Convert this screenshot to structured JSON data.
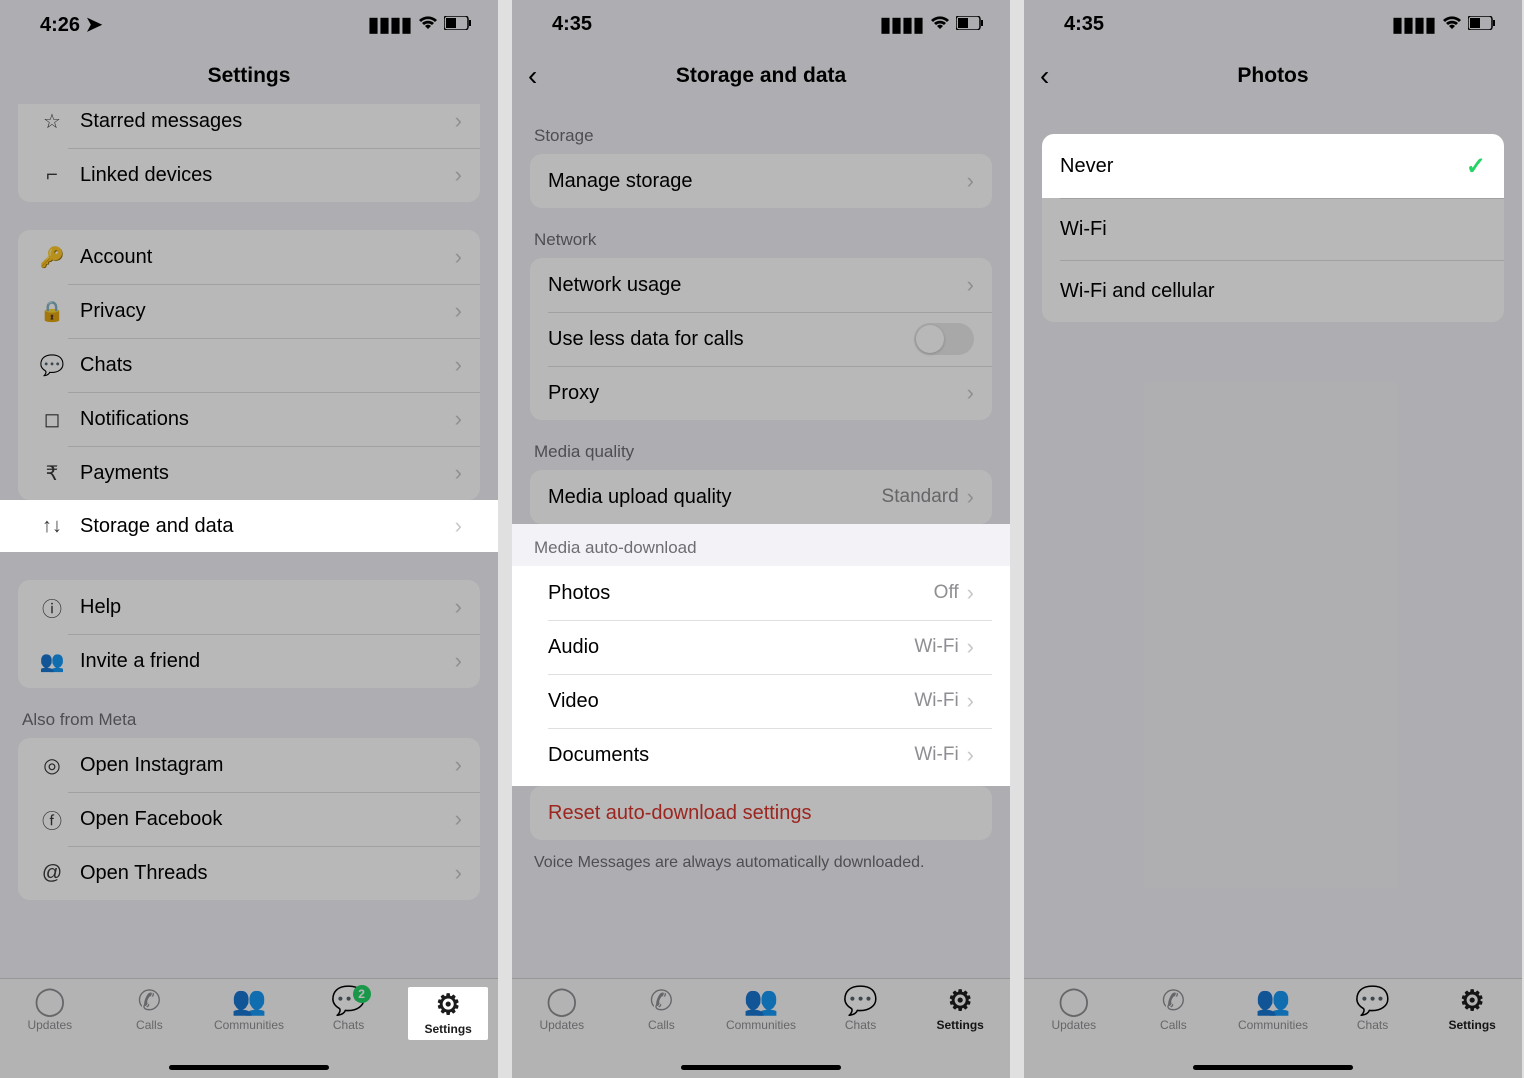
{
  "phone1": {
    "time": "4:26",
    "nav_title": "Settings",
    "rows": {
      "starred": "Starred messages",
      "linked": "Linked devices",
      "account": "Account",
      "privacy": "Privacy",
      "chats": "Chats",
      "notifications": "Notifications",
      "payments": "Payments",
      "storage": "Storage and data",
      "help": "Help",
      "invite": "Invite a friend"
    },
    "also_header": "Also from Meta",
    "meta": {
      "instagram": "Open Instagram",
      "facebook": "Open Facebook",
      "threads": "Open Threads"
    },
    "tabs": [
      "Updates",
      "Calls",
      "Communities",
      "Chats",
      "Settings"
    ],
    "badge": "2"
  },
  "phone2": {
    "time": "4:35",
    "nav_title": "Storage and data",
    "headers": {
      "storage": "Storage",
      "network": "Network",
      "quality": "Media quality",
      "autodl": "Media auto-download"
    },
    "rows": {
      "manage": "Manage storage",
      "usage": "Network usage",
      "lessdata": "Use less data for calls",
      "proxy": "Proxy",
      "upload": "Media upload quality",
      "upload_val": "Standard",
      "photos": "Photos",
      "photos_val": "Off",
      "audio": "Audio",
      "audio_val": "Wi-Fi",
      "video": "Video",
      "video_val": "Wi-Fi",
      "docs": "Documents",
      "docs_val": "Wi-Fi",
      "reset": "Reset auto-download settings"
    },
    "footnote": "Voice Messages are always automatically downloaded.",
    "tabs": [
      "Updates",
      "Calls",
      "Communities",
      "Chats",
      "Settings"
    ]
  },
  "phone3": {
    "time": "4:35",
    "nav_title": "Photos",
    "options": {
      "never": "Never",
      "wifi": "Wi-Fi",
      "cellular": "Wi-Fi and cellular"
    },
    "tabs": [
      "Updates",
      "Calls",
      "Communities",
      "Chats",
      "Settings"
    ]
  }
}
